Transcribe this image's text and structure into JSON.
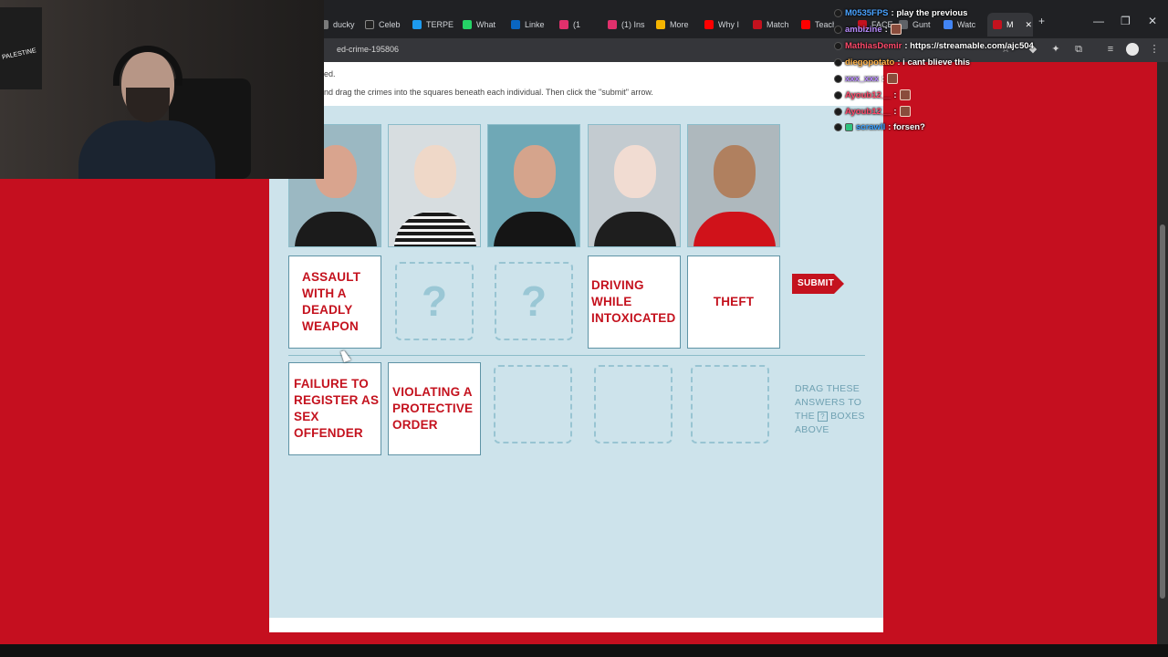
{
  "browser": {
    "tabs": [
      {
        "label": "ducky",
        "color": "#7a7a7a"
      },
      {
        "label": "Celeb",
        "color": "#222222"
      },
      {
        "label": "TERPE",
        "color": "#1d9bf0"
      },
      {
        "label": "What",
        "color": "#25d366"
      },
      {
        "label": "Linke",
        "color": "#0a66c2"
      },
      {
        "label": "(1",
        "color": "#e1306c"
      },
      {
        "label": "(1) Ins",
        "color": "#e1306c"
      },
      {
        "label": "More",
        "color": "#f4b400"
      },
      {
        "label": "Why I",
        "color": "#ff0000"
      },
      {
        "label": "Match",
        "color": "#c4121e"
      },
      {
        "label": "Teach",
        "color": "#ff0000"
      },
      {
        "label": "FACE",
        "color": "#c4121e"
      },
      {
        "label": "Gunt",
        "color": "#5f6368"
      },
      {
        "label": "Watc",
        "color": "#4285f4"
      },
      {
        "label": "M",
        "color": "#c4121e"
      }
    ],
    "new_tab": "+",
    "close_tab": "✕",
    "minimize": "—",
    "maximize": "❐",
    "close_window": "✕",
    "url": "ed-crime-195806"
  },
  "page": {
    "instruction_top": "ed.",
    "instruction": "nd drag the crimes into the squares beneath each individual. Then click the \"submit\" arrow.",
    "submit_label": "SUBMIT",
    "drag_hint_line1": "DRAG THESE",
    "drag_hint_line2": "ANSWERS TO",
    "drag_hint_pre": "THE",
    "drag_hint_box": "?",
    "drag_hint_post": "BOXES",
    "drag_hint_line4": "ABOVE",
    "question_mark": "?"
  },
  "answers_placed": [
    {
      "label": "ASSAULT WITH A DEADLY WEAPON"
    },
    {
      "label": "DRIVING WHILE INTOXICATED"
    },
    {
      "label": "THEFT"
    }
  ],
  "answer_pool": [
    {
      "label": "FAILURE TO REGISTER AS SEX OFFENDER"
    },
    {
      "label": "VIOLATING A PROTECTIVE ORDER"
    }
  ],
  "mugshots": [
    {
      "name": "mugshot-1",
      "bg": "#9bb8c2",
      "skin": "#d9a48e",
      "shirt": "#1b1b1b"
    },
    {
      "name": "mugshot-2",
      "bg": "#d7dde0",
      "skin": "#efd8c8",
      "shirt": "#2a2a2a"
    },
    {
      "name": "mugshot-3",
      "bg": "#6fa8b6",
      "skin": "#d5a48c",
      "shirt": "#151515"
    },
    {
      "name": "mugshot-4",
      "bg": "#c3cbd0",
      "skin": "#f1dcd2",
      "shirt": "#1e1e1e"
    },
    {
      "name": "mugshot-5",
      "bg": "#aeb8bd",
      "skin": "#b0805f",
      "shirt": "#d0121a"
    }
  ],
  "chat": [
    {
      "user": "M0535FPS",
      "color": "#4aa3ff",
      "msg": ": play the previous",
      "emote": false
    },
    {
      "user": "ambizine",
      "color": "#b98cff",
      "msg": ":",
      "emote": true
    },
    {
      "user": "MathiasDemir",
      "color": "#ff4a6b",
      "msg": ": https://streamable.com/ajc504",
      "emote": false
    },
    {
      "user": "diegopotato",
      "color": "#ffb347",
      "msg": ": i cant blieve this",
      "emote": false
    },
    {
      "user": "xxx_xxx",
      "color": "#b98cff",
      "msg": ":",
      "emote": true
    },
    {
      "user": "Ayoub12__",
      "color": "#ff4a6b",
      "msg": ":",
      "emote": true
    },
    {
      "user": "Ayoub12__",
      "color": "#ff4a6b",
      "msg": ":",
      "emote": true
    },
    {
      "user": "scrawll",
      "color": "#3aa0ff",
      "msg": ": forsen?",
      "emote": false
    }
  ],
  "webcam": {
    "flag_text": "PALESTINE"
  },
  "colors": {
    "accent": "#c4121e",
    "game_bg": "#cde3eb",
    "stream_bg": "#c50f1f"
  }
}
